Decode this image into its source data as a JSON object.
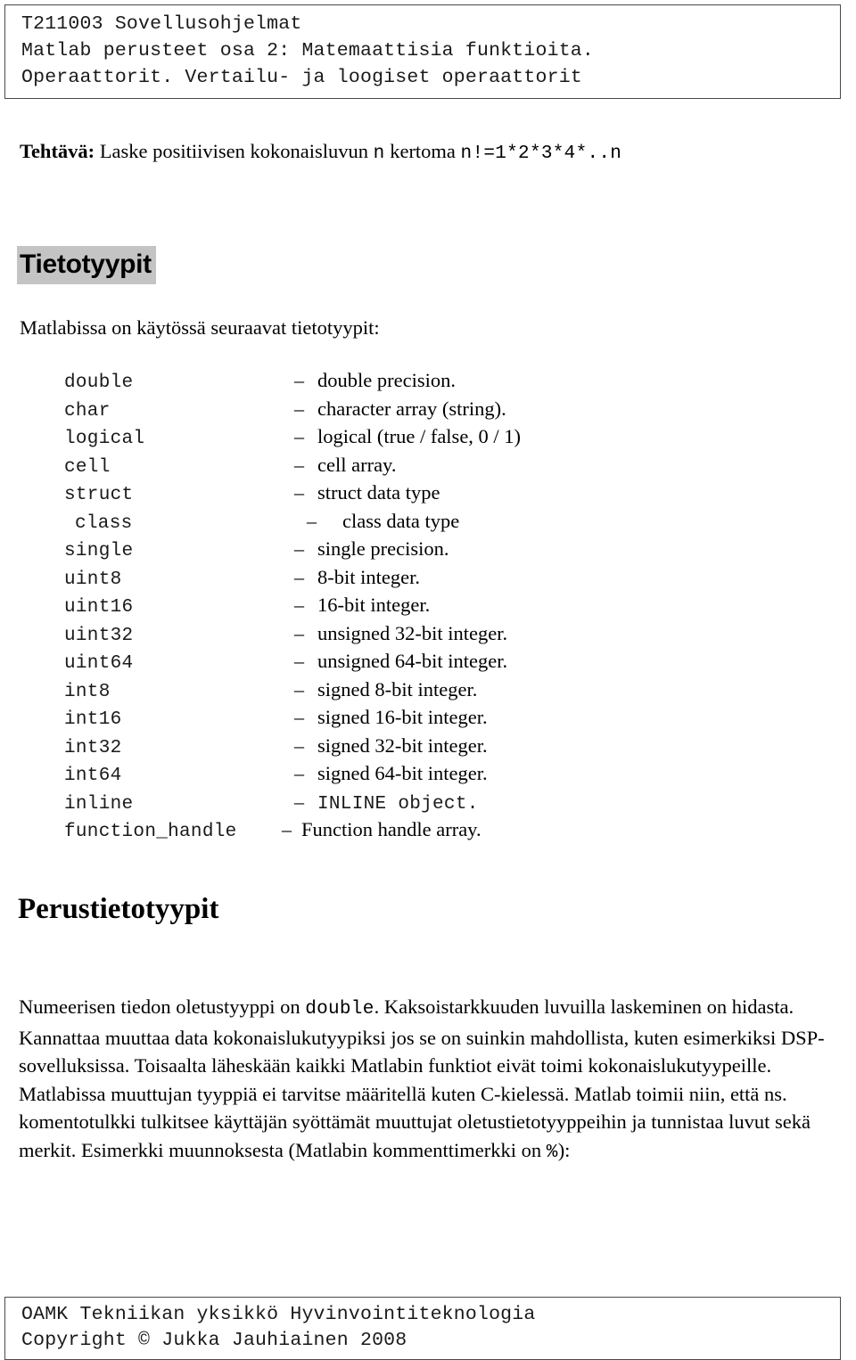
{
  "header": {
    "lines": [
      "T211003 Sovellusohjelmat",
      "Matlab perusteet osa 2: Matemaattisia funktioita.",
      "Operaattorit. Vertailu- ja loogiset operaattorit"
    ]
  },
  "task": {
    "label": "Tehtävä:",
    "text_before": " Laske positiivisen kokonaisluvun ",
    "variable": "n",
    "text_middle": " kertoma ",
    "formula": "n!=1*2*3*4*..n"
  },
  "section_tietotyypit": {
    "heading": "Tietotyypit",
    "intro": "Matlabissa on käytössä seuraavat tietotyypit:",
    "dash": "–",
    "types": [
      {
        "name": "double",
        "desc": "double precision.",
        "mono_desc": false,
        "indent": false,
        "wide": false
      },
      {
        "name": "char",
        "desc": "character array (string).",
        "mono_desc": false,
        "indent": false,
        "wide": false
      },
      {
        "name": "logical",
        "desc": "logical (true / false, 0 / 1)",
        "mono_desc": false,
        "indent": false,
        "wide": false
      },
      {
        "name": "cell",
        "desc": "cell array.",
        "mono_desc": false,
        "indent": false,
        "wide": false
      },
      {
        "name": "struct",
        "desc": "struct data type",
        "mono_desc": false,
        "indent": false,
        "wide": false
      },
      {
        "name": "class",
        "desc": "class data type",
        "mono_desc": false,
        "indent": true,
        "wide": false
      },
      {
        "name": "single",
        "desc": "single precision.",
        "mono_desc": false,
        "indent": false,
        "wide": false
      },
      {
        "name": "uint8",
        "desc": "8-bit integer.",
        "mono_desc": false,
        "indent": false,
        "wide": false
      },
      {
        "name": "uint16",
        "desc": "16-bit integer.",
        "mono_desc": false,
        "indent": false,
        "wide": false
      },
      {
        "name": "uint32",
        "desc": "unsigned 32-bit integer.",
        "mono_desc": false,
        "indent": false,
        "wide": false
      },
      {
        "name": "uint64",
        "desc": "unsigned 64-bit integer.",
        "mono_desc": false,
        "indent": false,
        "wide": false
      },
      {
        "name": "int8",
        "desc": "signed 8-bit integer.",
        "mono_desc": false,
        "indent": false,
        "wide": false
      },
      {
        "name": "int16",
        "desc": "signed 16-bit integer.",
        "mono_desc": false,
        "indent": false,
        "wide": false
      },
      {
        "name": "int32",
        "desc": "signed 32-bit integer.",
        "mono_desc": false,
        "indent": false,
        "wide": false
      },
      {
        "name": "int64",
        "desc": "signed 64-bit integer.",
        "mono_desc": false,
        "indent": false,
        "wide": false
      },
      {
        "name": "inline",
        "desc": "INLINE object.",
        "mono_desc": true,
        "indent": false,
        "wide": false
      },
      {
        "name": "function_handle",
        "desc": "Function handle array.",
        "mono_desc": false,
        "indent": false,
        "wide": true
      }
    ]
  },
  "section_perus": {
    "heading": "Perustietotyypit",
    "paragraph_part1": "Numeerisen tiedon oletustyyppi on ",
    "paragraph_code1": "double",
    "paragraph_part2": ". Kaksoistarkkuuden luvuilla laskeminen on hidasta. Kannattaa muuttaa data kokonaislukutyypiksi jos se on suinkin mahdollista, kuten esimerkiksi DSP-sovelluksissa. Toisaalta läheskään kaikki Matlabin funktiot eivät toimi kokonaislukutyypeille. Matlabissa muuttujan tyyppiä ei tarvitse määritellä kuten C-kielessä. Matlab toimii niin, että ns. komentotulkki tulkitsee käyttäjän syöttämät muuttujat oletustietotyyppeihin ja tunnistaa luvut sekä merkit. Esimerkki muunnoksesta (Matlabin kommenttimerkki on ",
    "paragraph_code2": "%",
    "paragraph_part3": "):"
  },
  "footer": {
    "lines": [
      "OAMK Tekniikan yksikkö Hyvinvointiteknologia",
      "Copyright © Jukka Jauhiainen 2008"
    ]
  },
  "colors": {
    "highlight": "#c4c4c4",
    "border": "#4a4a4a",
    "text": "#000000"
  }
}
